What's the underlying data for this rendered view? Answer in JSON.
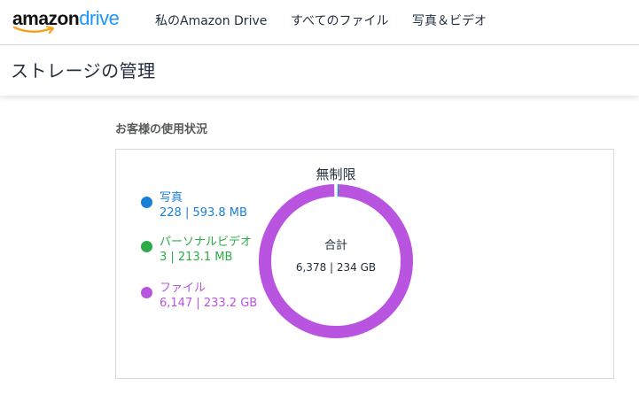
{
  "logo": {
    "amazon": "amazon",
    "drive": "drive"
  },
  "nav": [
    {
      "label": "私のAmazon Drive"
    },
    {
      "label": "すべてのファイル"
    },
    {
      "label": "写真＆ビデオ"
    }
  ],
  "page": {
    "title": "ストレージの管理"
  },
  "usage": {
    "section_title": "お客様の使用状況",
    "quota_label": "無制限",
    "total_label": "合計",
    "total_value": "6,378 | 234 GB",
    "categories": [
      {
        "name": "写真",
        "value": "228 | 593.8 MB",
        "color": "#1a7fd6",
        "gb": 0.5938
      },
      {
        "name": "パーソナルビデオ",
        "value": "3 | 213.1 MB",
        "color": "#2dab49",
        "gb": 0.2131
      },
      {
        "name": "ファイル",
        "value": "6,147 | 233.2 GB",
        "color": "#b954e0",
        "gb": 233.2
      }
    ]
  },
  "colors": {
    "brand_blue": "#1a98ff",
    "smile_orange": "#f7a21b"
  }
}
